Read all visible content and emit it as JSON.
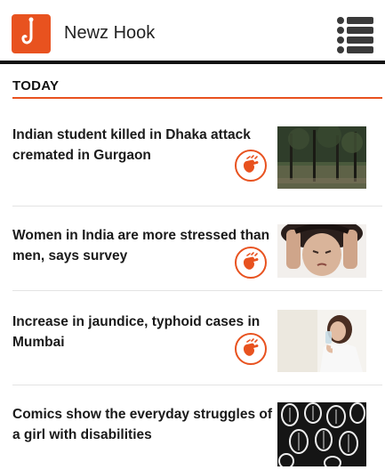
{
  "header": {
    "app_title": "Newz Hook",
    "logo_icon": "hook-icon",
    "menu_icon": "list-menu-icon",
    "accent_color": "#e8521f"
  },
  "section": {
    "title": "TODAY"
  },
  "articles": [
    {
      "headline": "Indian student killed in Dhaka attack cremated in Gurgaon",
      "badge_icon": "sign-language-hand-icon",
      "thumbnail": "trees-in-park-photo"
    },
    {
      "headline": "Women in India are more stressed than men, says survey",
      "badge_icon": "sign-language-hand-icon",
      "thumbnail": "stressed-woman-photo"
    },
    {
      "headline": "Increase in jaundice, typhoid cases in Mumbai",
      "badge_icon": "sign-language-hand-icon",
      "thumbnail": "woman-drinking-water-photo"
    },
    {
      "headline": "Comics show the everyday struggles of a girl with disabilities",
      "thumbnail": "black-white-comic-pattern"
    }
  ]
}
